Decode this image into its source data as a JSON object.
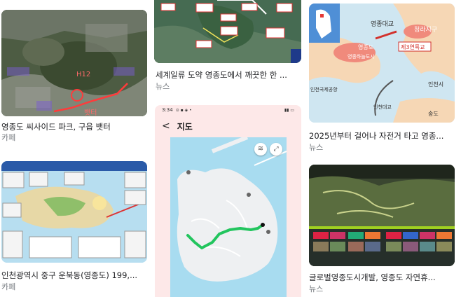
{
  "results": [
    {
      "title": "영종도 씨사이드 파크, 구읍 뱃터",
      "source": "카페",
      "map_labels": [
        "H12",
        "뱃터"
      ]
    },
    {
      "title": "세계일류 도약 영종도에서 깨끗한 한 ...",
      "source": "뉴스"
    },
    {
      "title": "2025년부터 걸어나 자전거 타고 영종...",
      "source": "뉴스",
      "map_labels": [
        "영종대교",
        "청라지구",
        "제3연륙교",
        "영종도",
        "영종하늘도시",
        "인천국제공항",
        "인천대교",
        "인천시",
        "송도"
      ]
    },
    {
      "title": "인천광역시 중구 운북동(영종도) 199,...",
      "source": "카페"
    },
    {
      "title": "글로벌영종도시개발, 영종도 자연휴...",
      "source": "뉴스"
    }
  ],
  "phone": {
    "time": "3:34",
    "header_title": "지도",
    "back_glyph": "<"
  },
  "colors": {
    "route_green": "#22c55e",
    "sea_blue": "#a8dcf0",
    "land_gray": "#eef0f2",
    "phone_header_bg": "#fde8e8",
    "route_red": "#ff3b3b"
  }
}
